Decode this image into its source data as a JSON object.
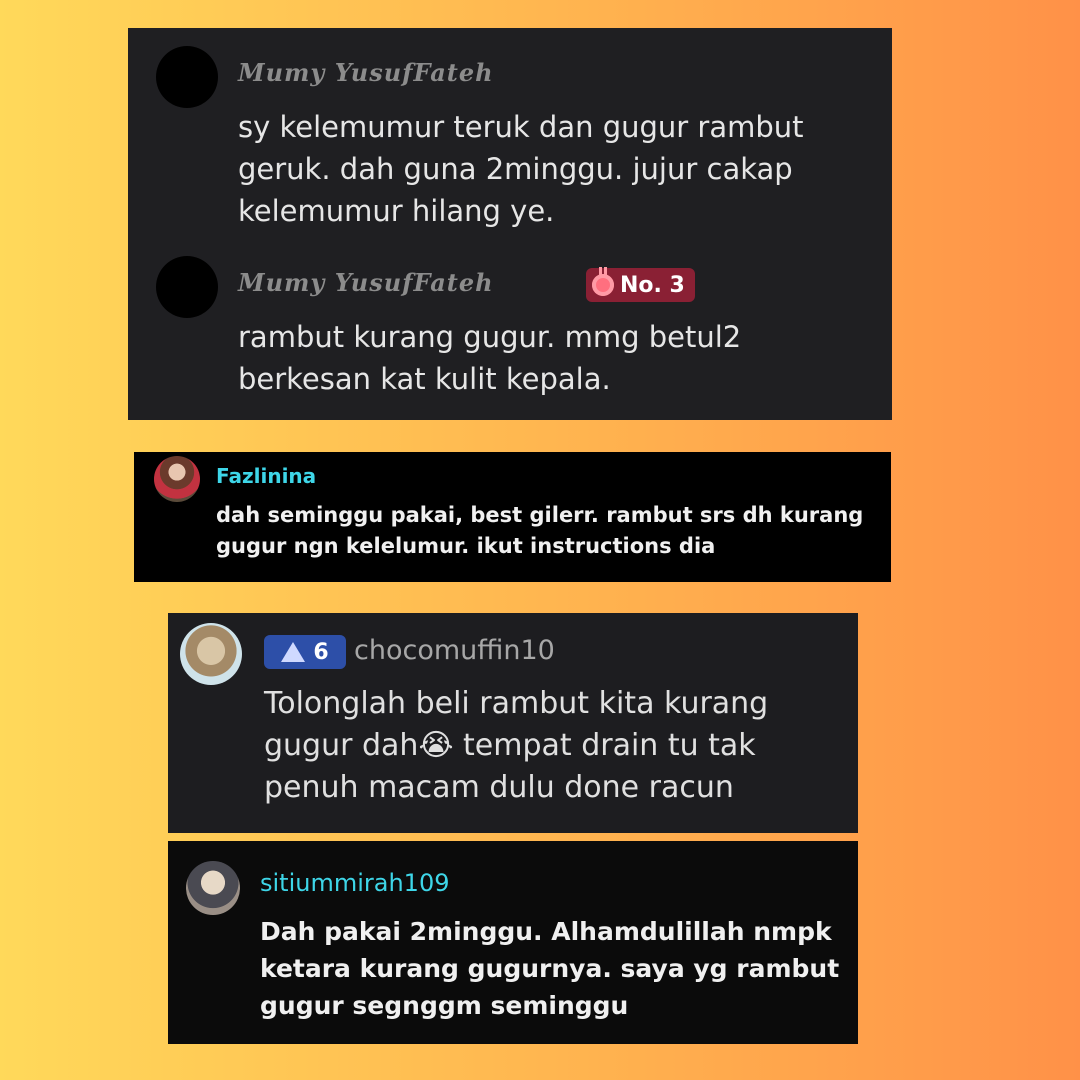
{
  "comments": [
    {
      "username": "Mumy YusufFateh",
      "text": "sy kelemumur teruk dan gugur rambut\ngeruk. dah guna 2minggu. jujur cakap\nkelemumur hilang ye."
    },
    {
      "username": "Mumy YusufFateh",
      "badge": "No. 3",
      "text": "rambut kurang gugur. mmg betul2\nberkesan kat kulit kepala."
    },
    {
      "username": "Fazlinina",
      "text": "dah seminggu pakai, best gilerr. rambut srs dh kurang\ngugur ngn kelelumur. ikut instructions dia"
    },
    {
      "username": "chocomuffin10",
      "level": "6",
      "text_before_emoji": "Tolonglah beli rambut kita kurang\ngugur dah",
      "emoji": "😭",
      "text_after_emoji": " tempat drain tu tak\npenuh macam dulu done racun"
    },
    {
      "username": "sitiummirah109",
      "text": "Dah pakai 2minggu. Alhamdulillah nmpk\nketara kurang gugurnya. saya yg rambut\ngugur segnggm seminggu"
    }
  ],
  "colors": {
    "accent_cyan": "#3ed6e8",
    "badge_red": "#8a2034",
    "badge_blue": "#2d4fa8"
  },
  "icons": [
    "medal-icon",
    "level-triangle-icon"
  ]
}
